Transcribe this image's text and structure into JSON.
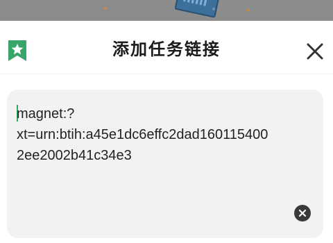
{
  "dialog": {
    "title": "添加任务链接",
    "bookmark_icon": "bookmark-star-icon",
    "close_icon": "close-icon"
  },
  "input": {
    "line1": "magnet:?",
    "line2": "xt=urn:btih:a45e1dc6effc2dad160115400",
    "line3": "2ee2002b41c34e3",
    "clear_icon": "clear-circle-icon"
  },
  "colors": {
    "accent": "#3aa56b",
    "backdrop": "#8c8c8c",
    "input_bg": "#f2f2f2"
  }
}
